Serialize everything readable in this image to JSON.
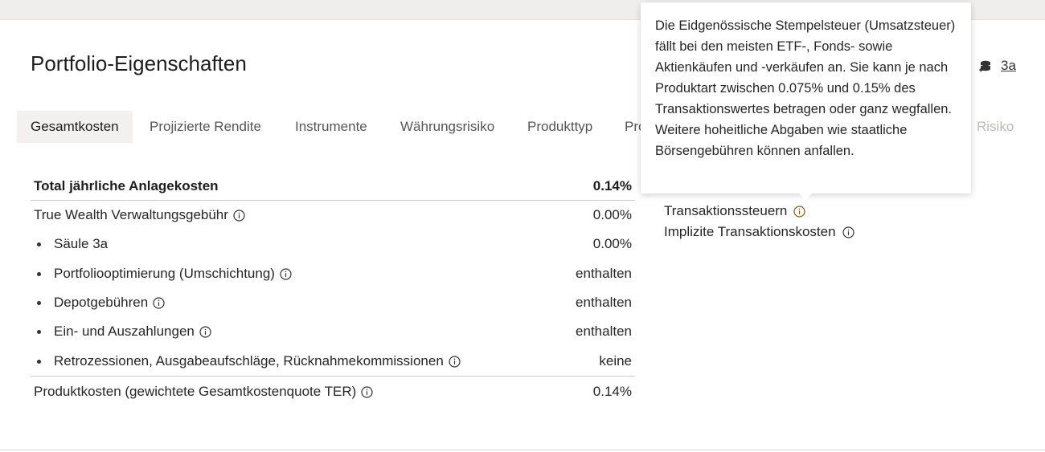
{
  "header": {
    "title": "Portfolio-Eigenschaften",
    "pillar_label": "3a"
  },
  "tabs": [
    {
      "label": "Gesamtkosten",
      "active": true
    },
    {
      "label": "Projizierte Rendite",
      "active": false
    },
    {
      "label": "Instrumente",
      "active": false
    },
    {
      "label": "Währungsrisiko",
      "active": false
    },
    {
      "label": "Produkttyp",
      "active": false
    },
    {
      "label": "Pro",
      "active": false
    },
    {
      "label": "Risiko",
      "active": false
    }
  ],
  "costs": {
    "total": {
      "label": "Total jährliche Anlagekosten",
      "value": "0.14%"
    },
    "management_fee": {
      "label": "True Wealth Verwaltungsgebühr",
      "value": "0.00%"
    },
    "items": [
      {
        "label": "Säule 3a",
        "value": "0.00%",
        "info": false
      },
      {
        "label": "Portfoliooptimierung (Umschichtung)",
        "value": "enthalten",
        "info": true
      },
      {
        "label": "Depotgebühren",
        "value": "enthalten",
        "info": true
      },
      {
        "label": "Ein- und Auszahlungen",
        "value": "enthalten",
        "info": true
      },
      {
        "label": "Retrozessionen, Ausgabeaufschläge, Rücknahmekommissionen",
        "value": "keine",
        "info": true
      }
    ],
    "product_costs": {
      "label": "Produktkosten (gewichtete Gesamtkostenquote TER)",
      "value": "0.14%"
    }
  },
  "other_costs": {
    "items": [
      {
        "label": "Transaktionssteuern"
      },
      {
        "label": "Implizite Transaktionskosten"
      }
    ]
  },
  "tooltip": {
    "text": "Die Eidgenössische Stempelsteuer (Umsatzsteuer) fällt bei den meisten ETF-, Fonds- sowie Aktienkäufen und -verkäufen an. Sie kann je nach Produktart zwischen 0.075% und 0.15% des Transaktionswertes betragen oder ganz wegfallen. Weitere hoheitliche Abgaben wie staatliche Börsengebühren können anfallen."
  },
  "colors": {
    "active_tab_bg": "#f2f1ef",
    "info_icon_active": "#8a5a1f",
    "divider": "#cfcdc9"
  }
}
